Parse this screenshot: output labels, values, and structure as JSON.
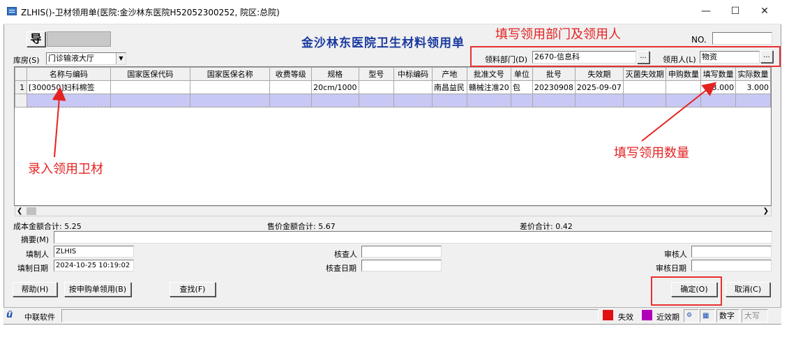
{
  "window": {
    "title": "ZLHIS()-卫材领用单(医院:金沙林东医院H52052300252, 院区:总院)"
  },
  "toolbar": {
    "guide_label": "导",
    "no_label": "NO.",
    "no_value": ""
  },
  "form": {
    "heading": "金沙林东医院卫生材料领用单",
    "storeroom_label": "库房(S)",
    "storeroom_value": "门诊输液大厅",
    "dept_label": "领料部门(D)",
    "dept_value": "2670-信息科",
    "receiver_label": "领用人(L)",
    "receiver_value": "物资",
    "ellipsis": "...",
    "cost_total": "成本金额合计: 5.25",
    "price_total": "售价金额合计: 5.67",
    "diff_total": "差价合计: 0.42",
    "summary_label": "摘要(M)",
    "summary_value": "",
    "creator_label": "填制人",
    "creator_value": "ZLHIS",
    "created_label": "填制日期",
    "created_value": "2024-10-25 10:19:02",
    "checker_label": "核查人",
    "checker_value": "",
    "check_date_label": "核查日期",
    "check_date_value": "",
    "auditor_label": "审核人",
    "auditor_value": "",
    "audit_date_label": "审核日期",
    "audit_date_value": ""
  },
  "grid": {
    "columns": [
      "名称与编码",
      "国家医保代码",
      "国家医保名称",
      "收费等级",
      "规格",
      "型号",
      "中标编码",
      "产地",
      "批准文号",
      "单位",
      "批号",
      "失效期",
      "灭菌失效期",
      "申购数量",
      "填写数量",
      "实际数量"
    ],
    "rows": [
      {
        "row_num": "1",
        "cells": [
          "[300050]妇科棉签",
          "",
          "",
          "",
          "20cm/1000",
          "",
          "",
          "南昌益民",
          "赣械注准20",
          "包",
          "20230908",
          "2025-09-07",
          "",
          "",
          "3.000",
          "3.000"
        ]
      }
    ]
  },
  "buttons": {
    "help": "帮助(H)",
    "by_purchase": "按申购单领用(B)",
    "find": "查找(F)",
    "ok": "确定(O)",
    "cancel": "取消(C)"
  },
  "annotations": {
    "fill_dept": "填写领用部门及领用人",
    "fill_qty": "填写领用数量",
    "enter_item": "录入领用卫材"
  },
  "statusbar": {
    "company": "中联软件",
    "expired_label": "失效",
    "near_expiry_label": "近效期",
    "num_label": "数字",
    "caps_label": "大写"
  },
  "colors": {
    "annotation_red": "#e52222",
    "expired": "#e01010",
    "near_expiry": "#b000b8",
    "heading_blue": "#1a3aa0",
    "selected_row": "#c8c8f4"
  }
}
